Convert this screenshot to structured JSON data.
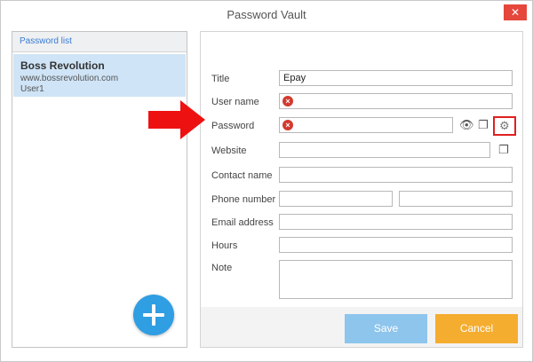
{
  "window": {
    "title": "Password Vault",
    "close_glyph": "✕"
  },
  "list": {
    "header": "Password list",
    "entries": [
      {
        "name": "Boss Revolution",
        "site": "www.bossrevolution.com",
        "user": "User1"
      }
    ],
    "add_glyph": "+"
  },
  "form": {
    "title_label": "Title",
    "title_value": "Epay",
    "username_label": "User name",
    "username_value": "",
    "password_label": "Password",
    "password_value": "",
    "website_label": "Website",
    "website_value": "",
    "contact_label": "Contact name",
    "contact_value": "",
    "phone_label": "Phone number",
    "phone_value": "",
    "phone_value2": "",
    "email_label": "Email address",
    "email_value": "",
    "hours_label": "Hours",
    "hours_value": "",
    "note_label": "Note",
    "note_value": "",
    "error_glyph": "×"
  },
  "icons": {
    "eye": "eye-icon",
    "copy": "copy-icon",
    "gear": "gear-icon",
    "error": "error-icon",
    "plus": "plus-icon",
    "arrow": "arrow-icon",
    "eye_glyph": "👁",
    "copy_glyph": "❐",
    "gear_glyph": "⚙"
  },
  "buttons": {
    "save": "Save",
    "cancel": "Cancel"
  },
  "colors": {
    "accent": "#2f9ee3",
    "selection": "#cfe4f6",
    "save": "#8ec5ec",
    "cancel": "#f5ad30",
    "error": "#d23a2f",
    "arrow": "#ee1111"
  }
}
